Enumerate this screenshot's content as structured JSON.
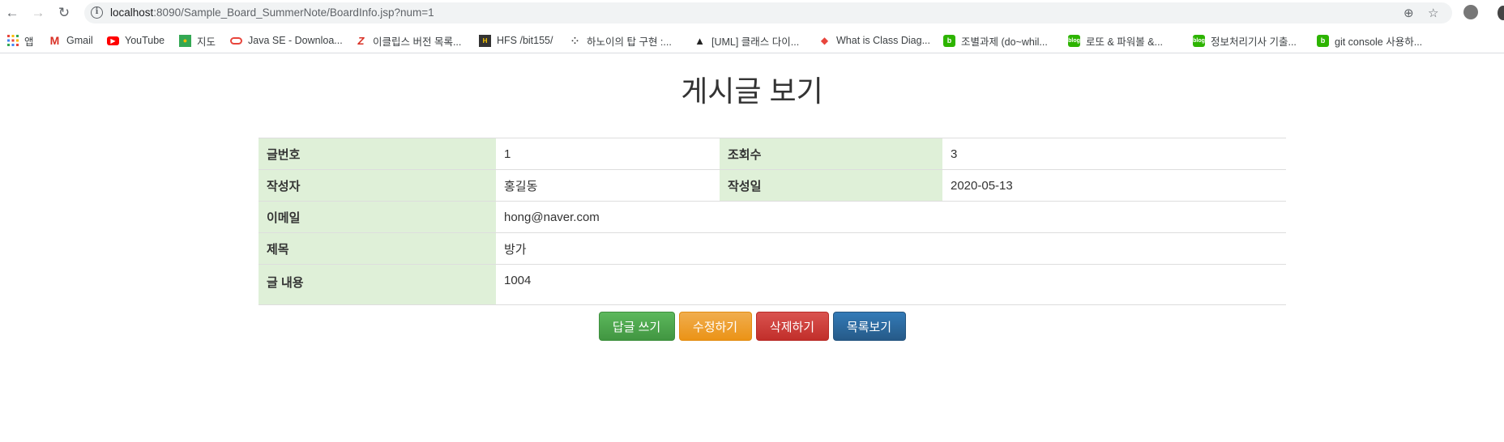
{
  "browser": {
    "url_host": "localhost",
    "url_rest": ":8090/Sample_Board_SummerNote/BoardInfo.jsp?num=1",
    "bookmarks": [
      {
        "label": "앱",
        "icon": "apps-grid-icon",
        "color": "#e8453c"
      },
      {
        "label": "Gmail",
        "icon": "gmail-icon",
        "color": "#d93025"
      },
      {
        "label": "YouTube",
        "icon": "youtube-icon",
        "color": "#ff0000"
      },
      {
        "label": "지도",
        "icon": "maps-icon",
        "color": "#34a853"
      },
      {
        "label": "Java SE - Downloa...",
        "icon": "oracle-icon",
        "color": "#e8453c"
      },
      {
        "label": "이클립스 버전 목록...",
        "icon": "z-icon",
        "color": "#d93025"
      },
      {
        "label": "HFS /bit155/",
        "icon": "hfs-icon",
        "color": "#333333"
      },
      {
        "label": "하노이의 탑 구현 :...",
        "icon": "dots-icon",
        "color": "#333333"
      },
      {
        "label": "[UML] 클래스 다이...",
        "icon": "penguin-icon",
        "color": "#333333"
      },
      {
        "label": "What is Class Diag...",
        "icon": "diamond-icon",
        "color": "#e8453c"
      },
      {
        "label": "조별과제 (do~whil...",
        "icon": "blog-icon",
        "color": "#2db400"
      },
      {
        "label": "로또 & 파워볼 &...",
        "icon": "blog-icon",
        "color": "#2db400"
      },
      {
        "label": "정보처리기사 기출...",
        "icon": "blog-icon",
        "color": "#2db400"
      },
      {
        "label": "git console 사용하...",
        "icon": "blog-icon",
        "color": "#2db400"
      }
    ]
  },
  "page": {
    "title": "게시글 보기",
    "fields": {
      "num_label": "글번호",
      "num_value": "1",
      "views_label": "조회수",
      "views_value": "3",
      "writer_label": "작성자",
      "writer_value": "홍길동",
      "date_label": "작성일",
      "date_value": "2020-05-13",
      "email_label": "이메일",
      "email_value": "hong@naver.com",
      "subject_label": "제목",
      "subject_value": "방가",
      "content_label": "글 내용",
      "content_value": "1004"
    },
    "buttons": {
      "reply": "답글 쓰기",
      "edit": "수정하기",
      "delete": "삭제하기",
      "list": "목록보기"
    }
  }
}
